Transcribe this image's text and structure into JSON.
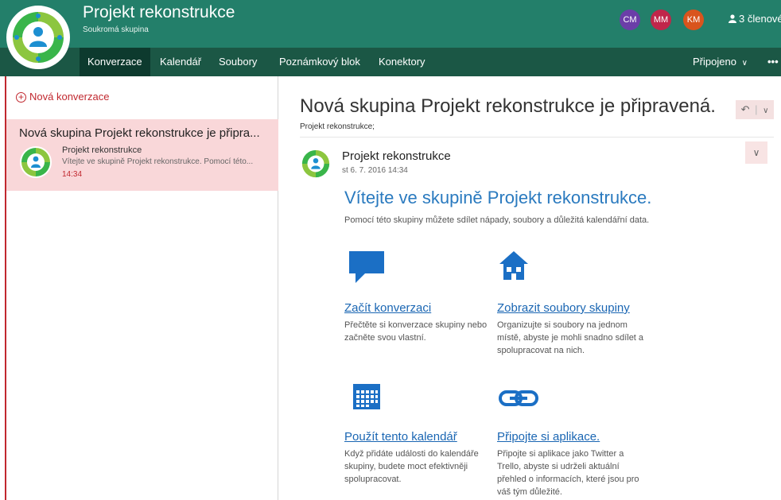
{
  "header": {
    "title": "Projekt rekonstrukce",
    "subtitle": "Soukromá skupina",
    "avatars": [
      {
        "initials": "CM",
        "color": "#6b3ea8"
      },
      {
        "initials": "MM",
        "color": "#c0264a"
      },
      {
        "initials": "KM",
        "color": "#d9541d"
      }
    ],
    "members": "3 členové"
  },
  "nav": {
    "items": [
      "Konverzace",
      "Kalendář",
      "Soubory",
      "Poznámkový blok",
      "Konektory"
    ],
    "connected": "Připojeno",
    "more": "•••"
  },
  "left": {
    "new_conversation": "Nová konverzace",
    "conversation": {
      "title": "Nová skupina Projekt rekonstrukce je připra...",
      "sender": "Projekt rekonstrukce",
      "preview": "Vítejte ve skupině Projekt rekonstrukce. Pomocí této...",
      "time": "14:34"
    }
  },
  "main": {
    "title": "Nová skupina Projekt rekonstrukce je připravená.",
    "to": "Projekt rekonstrukce;",
    "sender": "Projekt rekonstrukce",
    "date": "st 6. 7. 2016 14:34",
    "welcome": "Vítejte ve skupině Projekt rekonstrukce.",
    "welcome_sub": "Pomocí této skupiny můžete sdílet nápady, soubory a důležitá kalendářní data.",
    "tiles": [
      {
        "link": "Začít konverzaci",
        "desc": "Přečtěte si konverzace skupiny nebo začněte svou vlastní.",
        "icon": "chat-bubble-icon"
      },
      {
        "link": "Zobrazit soubory skupiny",
        "desc": "Organizujte si soubory na jednom místě, abyste je mohli snadno sdílet a spolupracovat na nich.",
        "icon": "home-icon"
      },
      {
        "link": "Použít tento kalendář",
        "desc": "Když přidáte události do kalendáře skupiny, budete moct efektivněji spolupracovat.",
        "icon": "calendar-icon"
      },
      {
        "link": "Připojte si aplikace.",
        "desc": "Připojte si aplikace jako Twitter a Trello, abyste si udrželi aktuální přehled o informacích, které jsou pro váš tým důležité.",
        "icon": "link-icon"
      }
    ]
  },
  "colors": {
    "header_bg": "#237f6a",
    "nav_bg": "#1b5745",
    "accent_red": "#c1282f",
    "link_blue": "#1a66b3"
  }
}
